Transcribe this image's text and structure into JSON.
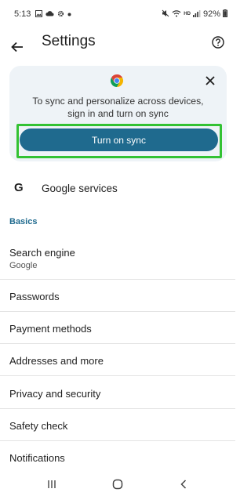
{
  "status_bar": {
    "time": "5:13",
    "battery": "92%",
    "network_badge": "HD"
  },
  "header": {
    "title": "Settings"
  },
  "sync_card": {
    "message_line1": "To sync and personalize across devices,",
    "message_line2": "sign in and turn on sync",
    "button_label": "Turn on sync"
  },
  "google_services": {
    "icon": "G",
    "label": "Google services"
  },
  "basics": {
    "header": "Basics",
    "items": [
      {
        "label": "Search engine",
        "sub": "Google"
      },
      {
        "label": "Passwords"
      },
      {
        "label": "Payment methods"
      },
      {
        "label": "Addresses and more"
      },
      {
        "label": "Privacy and security"
      },
      {
        "label": "Safety check"
      },
      {
        "label": "Notifications"
      }
    ]
  },
  "colors": {
    "accent": "#1f6a8e",
    "card_bg": "#eef3f7",
    "highlight": "#33c233"
  },
  "icons": [
    "back-arrow-icon",
    "help-icon",
    "chrome-logo-icon",
    "close-icon",
    "google-g-icon",
    "recents-icon",
    "home-icon",
    "back-nav-icon"
  ]
}
